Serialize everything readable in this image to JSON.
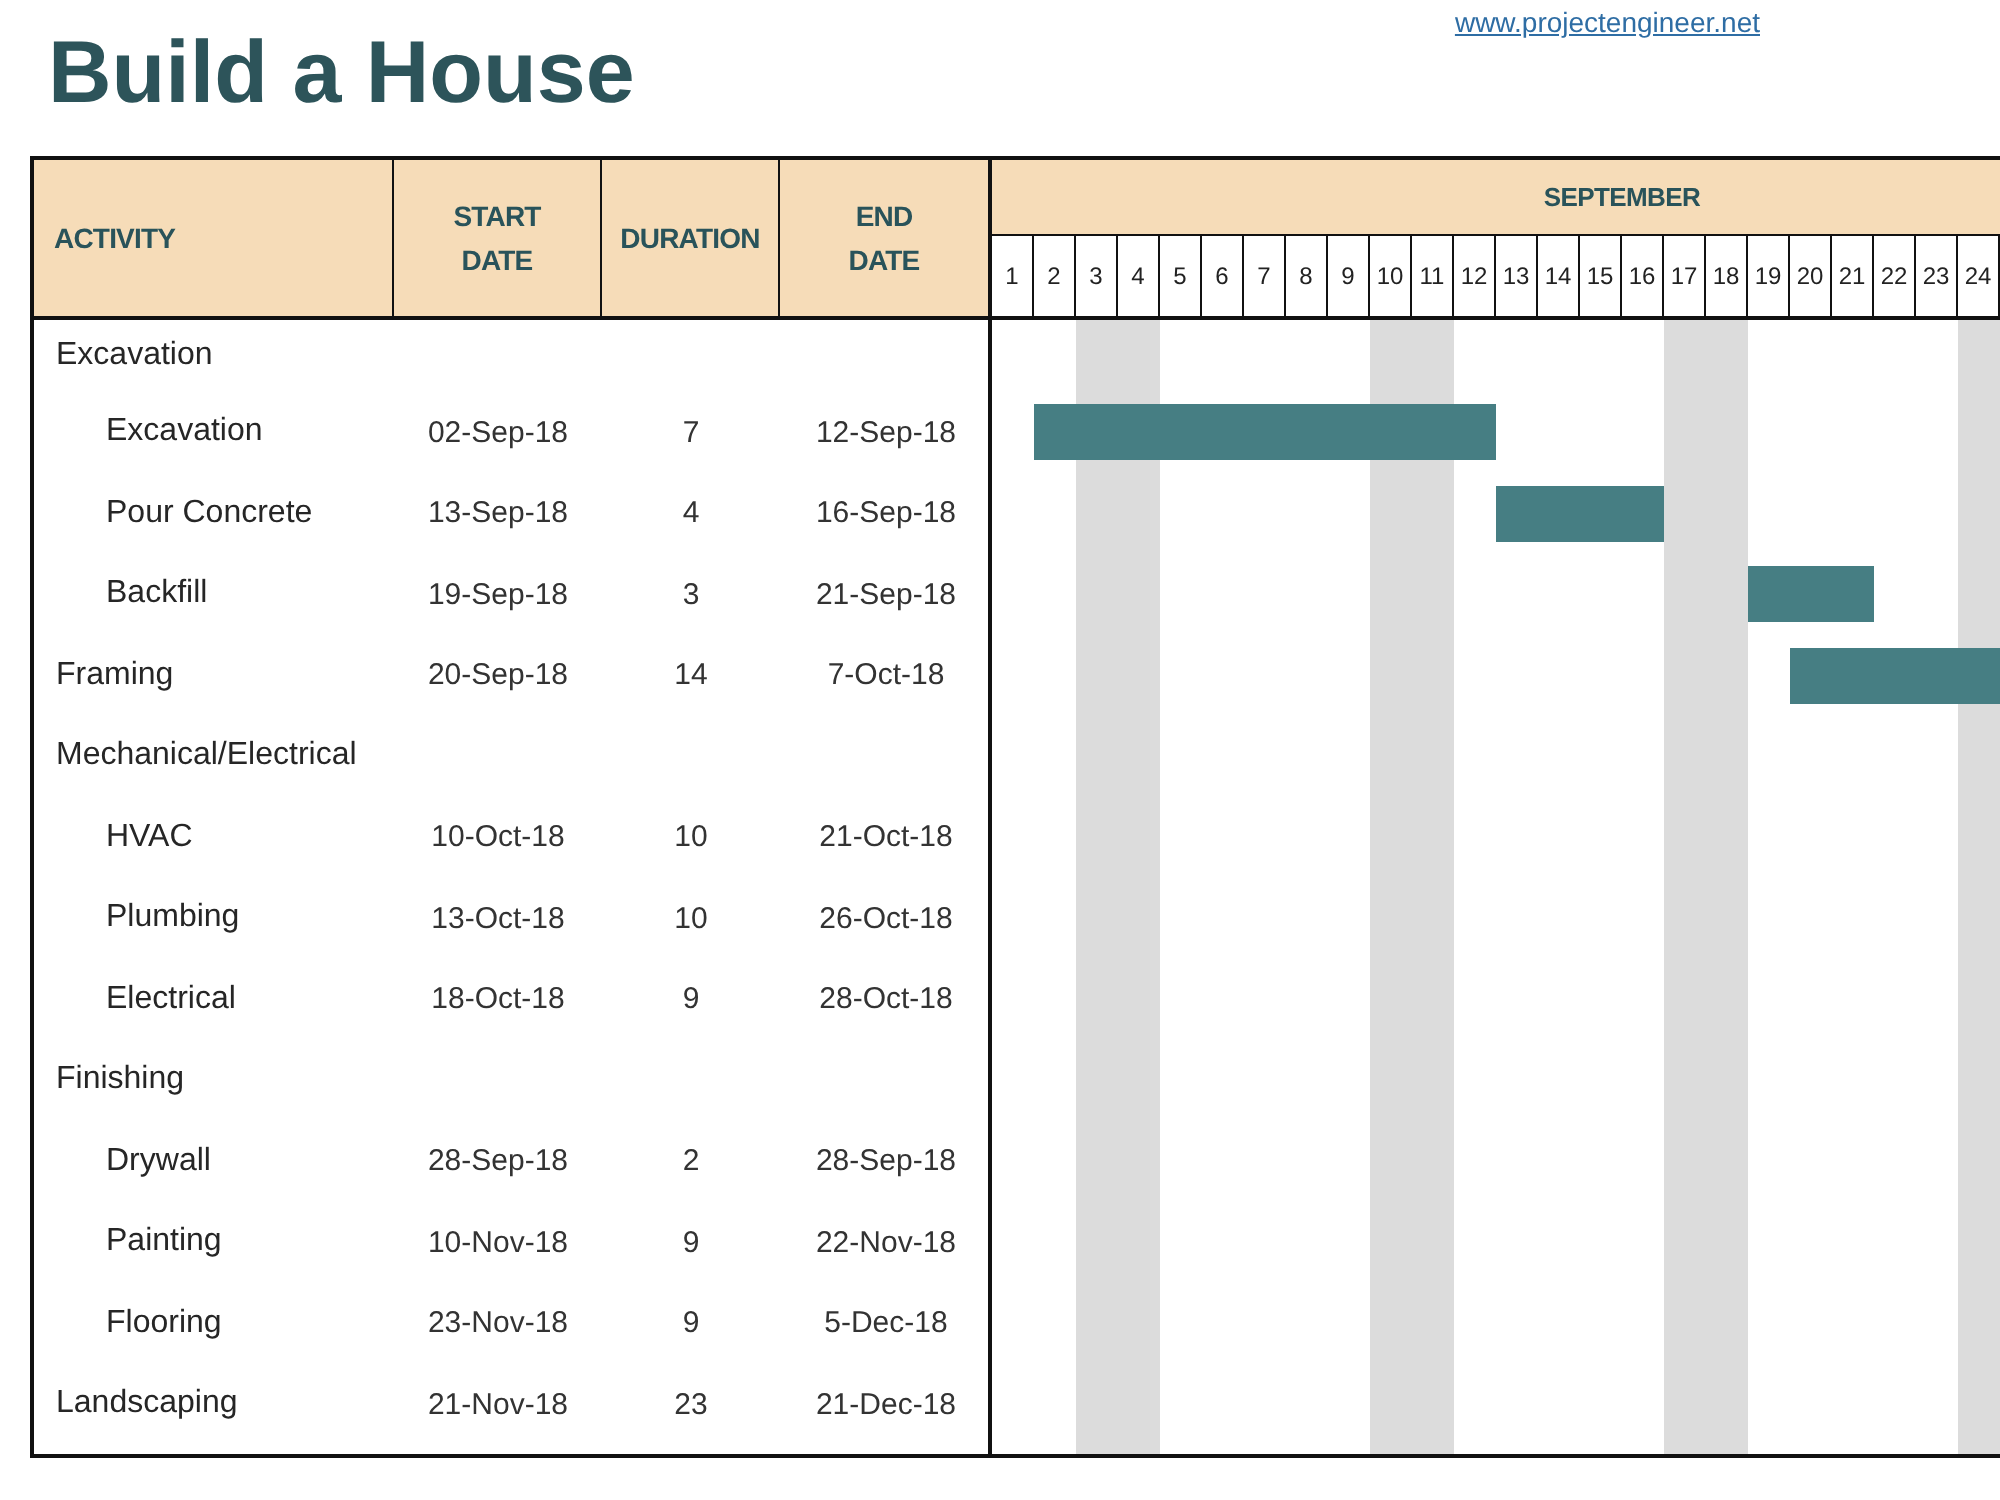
{
  "title": "Build a House",
  "link": "www.projectengineer.net",
  "columns": [
    "ACTIVITY",
    "START DATE",
    "DURATION",
    "END DATE"
  ],
  "gantt": {
    "month": "SEPTEMBER",
    "days": [
      {
        "label": "1",
        "shaded": false
      },
      {
        "label": "2",
        "shaded": false
      },
      {
        "label": "3",
        "shaded": true
      },
      {
        "label": "4",
        "shaded": true
      },
      {
        "label": "5",
        "shaded": false
      },
      {
        "label": "6",
        "shaded": false
      },
      {
        "label": "7",
        "shaded": false
      },
      {
        "label": "8",
        "shaded": false
      },
      {
        "label": "9",
        "shaded": false
      },
      {
        "label": "10",
        "shaded": true
      },
      {
        "label": "11",
        "shaded": true
      },
      {
        "label": "12",
        "shaded": false
      },
      {
        "label": "13",
        "shaded": false
      },
      {
        "label": "14",
        "shaded": false
      },
      {
        "label": "15",
        "shaded": false
      },
      {
        "label": "16",
        "shaded": false
      },
      {
        "label": "17",
        "shaded": true
      },
      {
        "label": "18",
        "shaded": true
      },
      {
        "label": "19",
        "shaded": false
      },
      {
        "label": "20",
        "shaded": false
      },
      {
        "label": "21",
        "shaded": false
      },
      {
        "label": "22",
        "shaded": false
      },
      {
        "label": "23",
        "shaded": false
      },
      {
        "label": "24",
        "shaded": true
      }
    ]
  },
  "rows": [
    {
      "kind": "group",
      "activity": "Excavation"
    },
    {
      "kind": "task",
      "activity": "Excavation",
      "start": "02-Sep-18",
      "duration": "7",
      "end": "12-Sep-18",
      "timeline": [
        {
          "kind": "blank"
        },
        {
          "kind": "bar"
        },
        {
          "kind": "bar"
        },
        {
          "kind": "bar"
        },
        {
          "kind": "bar"
        },
        {
          "kind": "bar"
        },
        {
          "kind": "bar"
        },
        {
          "kind": "bar"
        },
        {
          "kind": "bar"
        },
        {
          "kind": "bar"
        },
        {
          "kind": "bar"
        },
        {
          "kind": "bar"
        },
        {
          "kind": "blank"
        },
        {
          "kind": "blank"
        },
        {
          "kind": "blank"
        },
        {
          "kind": "blank"
        },
        {
          "kind": "blank"
        },
        {
          "kind": "blank"
        },
        {
          "kind": "blank"
        },
        {
          "kind": "blank"
        },
        {
          "kind": "blank"
        },
        {
          "kind": "blank"
        },
        {
          "kind": "blank"
        },
        {
          "kind": "blank"
        }
      ]
    },
    {
      "kind": "task",
      "activity": "Pour Concrete",
      "start": "13-Sep-18",
      "duration": "4",
      "end": "16-Sep-18",
      "timeline": [
        {
          "kind": "blank"
        },
        {
          "kind": "blank"
        },
        {
          "kind": "blank"
        },
        {
          "kind": "blank"
        },
        {
          "kind": "blank"
        },
        {
          "kind": "blank"
        },
        {
          "kind": "blank"
        },
        {
          "kind": "blank"
        },
        {
          "kind": "blank"
        },
        {
          "kind": "blank"
        },
        {
          "kind": "blank"
        },
        {
          "kind": "blank"
        },
        {
          "kind": "bar"
        },
        {
          "kind": "bar"
        },
        {
          "kind": "bar"
        },
        {
          "kind": "bar"
        },
        {
          "kind": "blank"
        },
        {
          "kind": "blank"
        },
        {
          "kind": "blank"
        },
        {
          "kind": "blank"
        },
        {
          "kind": "blank"
        },
        {
          "kind": "blank"
        },
        {
          "kind": "blank"
        },
        {
          "kind": "blank"
        }
      ]
    },
    {
      "kind": "task",
      "activity": "Backfill",
      "start": "19-Sep-18",
      "duration": "3",
      "end": "21-Sep-18",
      "timeline": [
        {
          "kind": "blank"
        },
        {
          "kind": "blank"
        },
        {
          "kind": "blank"
        },
        {
          "kind": "blank"
        },
        {
          "kind": "blank"
        },
        {
          "kind": "blank"
        },
        {
          "kind": "blank"
        },
        {
          "kind": "blank"
        },
        {
          "kind": "blank"
        },
        {
          "kind": "blank"
        },
        {
          "kind": "blank"
        },
        {
          "kind": "blank"
        },
        {
          "kind": "blank"
        },
        {
          "kind": "blank"
        },
        {
          "kind": "blank"
        },
        {
          "kind": "blank"
        },
        {
          "kind": "blank"
        },
        {
          "kind": "blank"
        },
        {
          "kind": "bar"
        },
        {
          "kind": "bar"
        },
        {
          "kind": "bar"
        },
        {
          "kind": "blank"
        },
        {
          "kind": "blank"
        },
        {
          "kind": "blank"
        }
      ]
    },
    {
      "kind": "group",
      "activity": "Framing",
      "start": "20-Sep-18",
      "duration": "14",
      "end": "7-Oct-18",
      "timeline": [
        {
          "kind": "blank"
        },
        {
          "kind": "blank"
        },
        {
          "kind": "blank"
        },
        {
          "kind": "blank"
        },
        {
          "kind": "blank"
        },
        {
          "kind": "blank"
        },
        {
          "kind": "blank"
        },
        {
          "kind": "blank"
        },
        {
          "kind": "blank"
        },
        {
          "kind": "blank"
        },
        {
          "kind": "blank"
        },
        {
          "kind": "blank"
        },
        {
          "kind": "blank"
        },
        {
          "kind": "blank"
        },
        {
          "kind": "blank"
        },
        {
          "kind": "blank"
        },
        {
          "kind": "blank"
        },
        {
          "kind": "blank"
        },
        {
          "kind": "blank"
        },
        {
          "kind": "bar"
        },
        {
          "kind": "bar"
        },
        {
          "kind": "bar"
        },
        {
          "kind": "bar"
        },
        {
          "kind": "bar"
        }
      ]
    },
    {
      "kind": "group",
      "activity": "Mechanical/Electrical"
    },
    {
      "kind": "task",
      "activity": "HVAC",
      "start": "10-Oct-18",
      "duration": "10",
      "end": "21-Oct-18"
    },
    {
      "kind": "task",
      "activity": "Plumbing",
      "start": "13-Oct-18",
      "duration": "10",
      "end": "26-Oct-18"
    },
    {
      "kind": "task",
      "activity": "Electrical",
      "start": "18-Oct-18",
      "duration": "9",
      "end": "28-Oct-18"
    },
    {
      "kind": "group",
      "activity": "Finishing"
    },
    {
      "kind": "task",
      "activity": "Drywall",
      "start": "28-Sep-18",
      "duration": "2",
      "end": "28-Sep-18"
    },
    {
      "kind": "task",
      "activity": "Painting",
      "start": "10-Nov-18",
      "duration": "9",
      "end": "22-Nov-18"
    },
    {
      "kind": "task",
      "activity": "Flooring",
      "start": "23-Nov-18",
      "duration": "9",
      "end": "5-Dec-18"
    },
    {
      "kind": "group",
      "activity": "Landscaping",
      "start": "21-Nov-18",
      "duration": "23",
      "end": "21-Dec-18"
    }
  ]
}
